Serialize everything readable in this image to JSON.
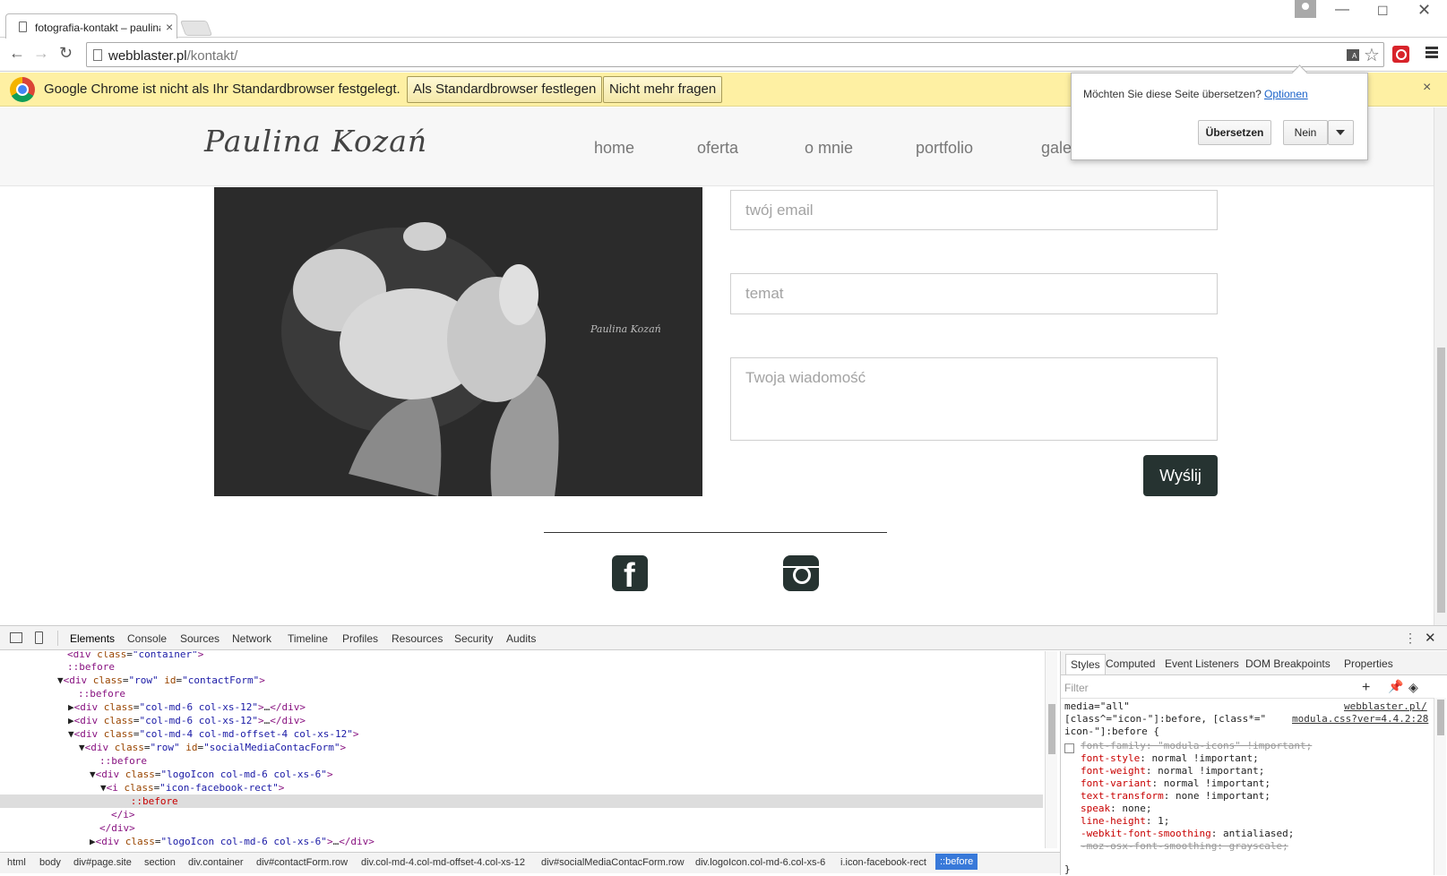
{
  "tab": {
    "title": "fotografia-kontakt – paulina"
  },
  "toolbar": {
    "url_host": "webblaster.pl",
    "url_path": "/kontakt/"
  },
  "infobar": {
    "message": "Google Chrome ist nicht als Ihr Standardbrowser festgelegt.",
    "set_default": "Als Standardbrowser festlegen",
    "dont_ask": "Nicht mehr fragen"
  },
  "translate": {
    "question": "Möchten Sie diese Seite übersetzen?",
    "options": "Optionen",
    "translate_btn": "Übersetzen",
    "no_btn": "Nein"
  },
  "site": {
    "logo": "Paulina Kozań",
    "nav": [
      "home",
      "oferta",
      "o mnie",
      "portfolio",
      "gale"
    ],
    "photo_signature": "Paulina Kozań",
    "email_placeholder": "twój email",
    "subject_placeholder": "temat",
    "message_placeholder": "Twoja wiadomość",
    "send_label": "Wyślij"
  },
  "devtools": {
    "tabs": [
      "Elements",
      "Console",
      "Sources",
      "Network",
      "Timeline",
      "Profiles",
      "Resources",
      "Security",
      "Audits"
    ],
    "styles_tabs": [
      "Styles",
      "Computed",
      "Event Listeners",
      "DOM Breakpoints",
      "Properties"
    ],
    "filter_placeholder": "Filter",
    "breadcrumbs": [
      "html",
      "body",
      "div#page.site",
      "section",
      "div.container",
      "div#contactForm.row",
      "div.col-md-4.col-md-offset-4.col-xs-12",
      "div#socialMediaContacForm.row",
      "div.logoIcon.col-md-6.col-xs-6",
      "i.icon-facebook-rect",
      "::before"
    ],
    "style_link_1": "webblaster.pl/",
    "style_link_2": "modula.css?ver=4.4.2:28",
    "style_media": "media=\"all\"",
    "style_selector_1": "[class^=\"icon-\"]:before, [class*=\"",
    "style_selector_2": "icon-\"]:before {",
    "style_props": [
      {
        "name": "font-family",
        "value": "\"modula-icons\" !important;",
        "struck": true
      },
      {
        "name": "font-style",
        "value": "normal !important;",
        "struck": false
      },
      {
        "name": "font-weight",
        "value": "normal !important;",
        "struck": false
      },
      {
        "name": "font-variant",
        "value": "normal !important;",
        "struck": false
      },
      {
        "name": "text-transform",
        "value": "none !important;",
        "struck": false
      },
      {
        "name": "speak",
        "value": "none;",
        "struck": false
      },
      {
        "name": "line-height",
        "value": "1;",
        "struck": false
      },
      {
        "name": "-webkit-font-smoothing",
        "value": "antialiased;",
        "struck": false
      },
      {
        "name": "-moz-osx-font-smoothing",
        "value": "grayscale;",
        "struck": true
      }
    ],
    "style_close": "}"
  },
  "colors": {
    "accent_button": "#263331",
    "infobar": "#fef0a3",
    "crumb_active": "#3879d9"
  }
}
